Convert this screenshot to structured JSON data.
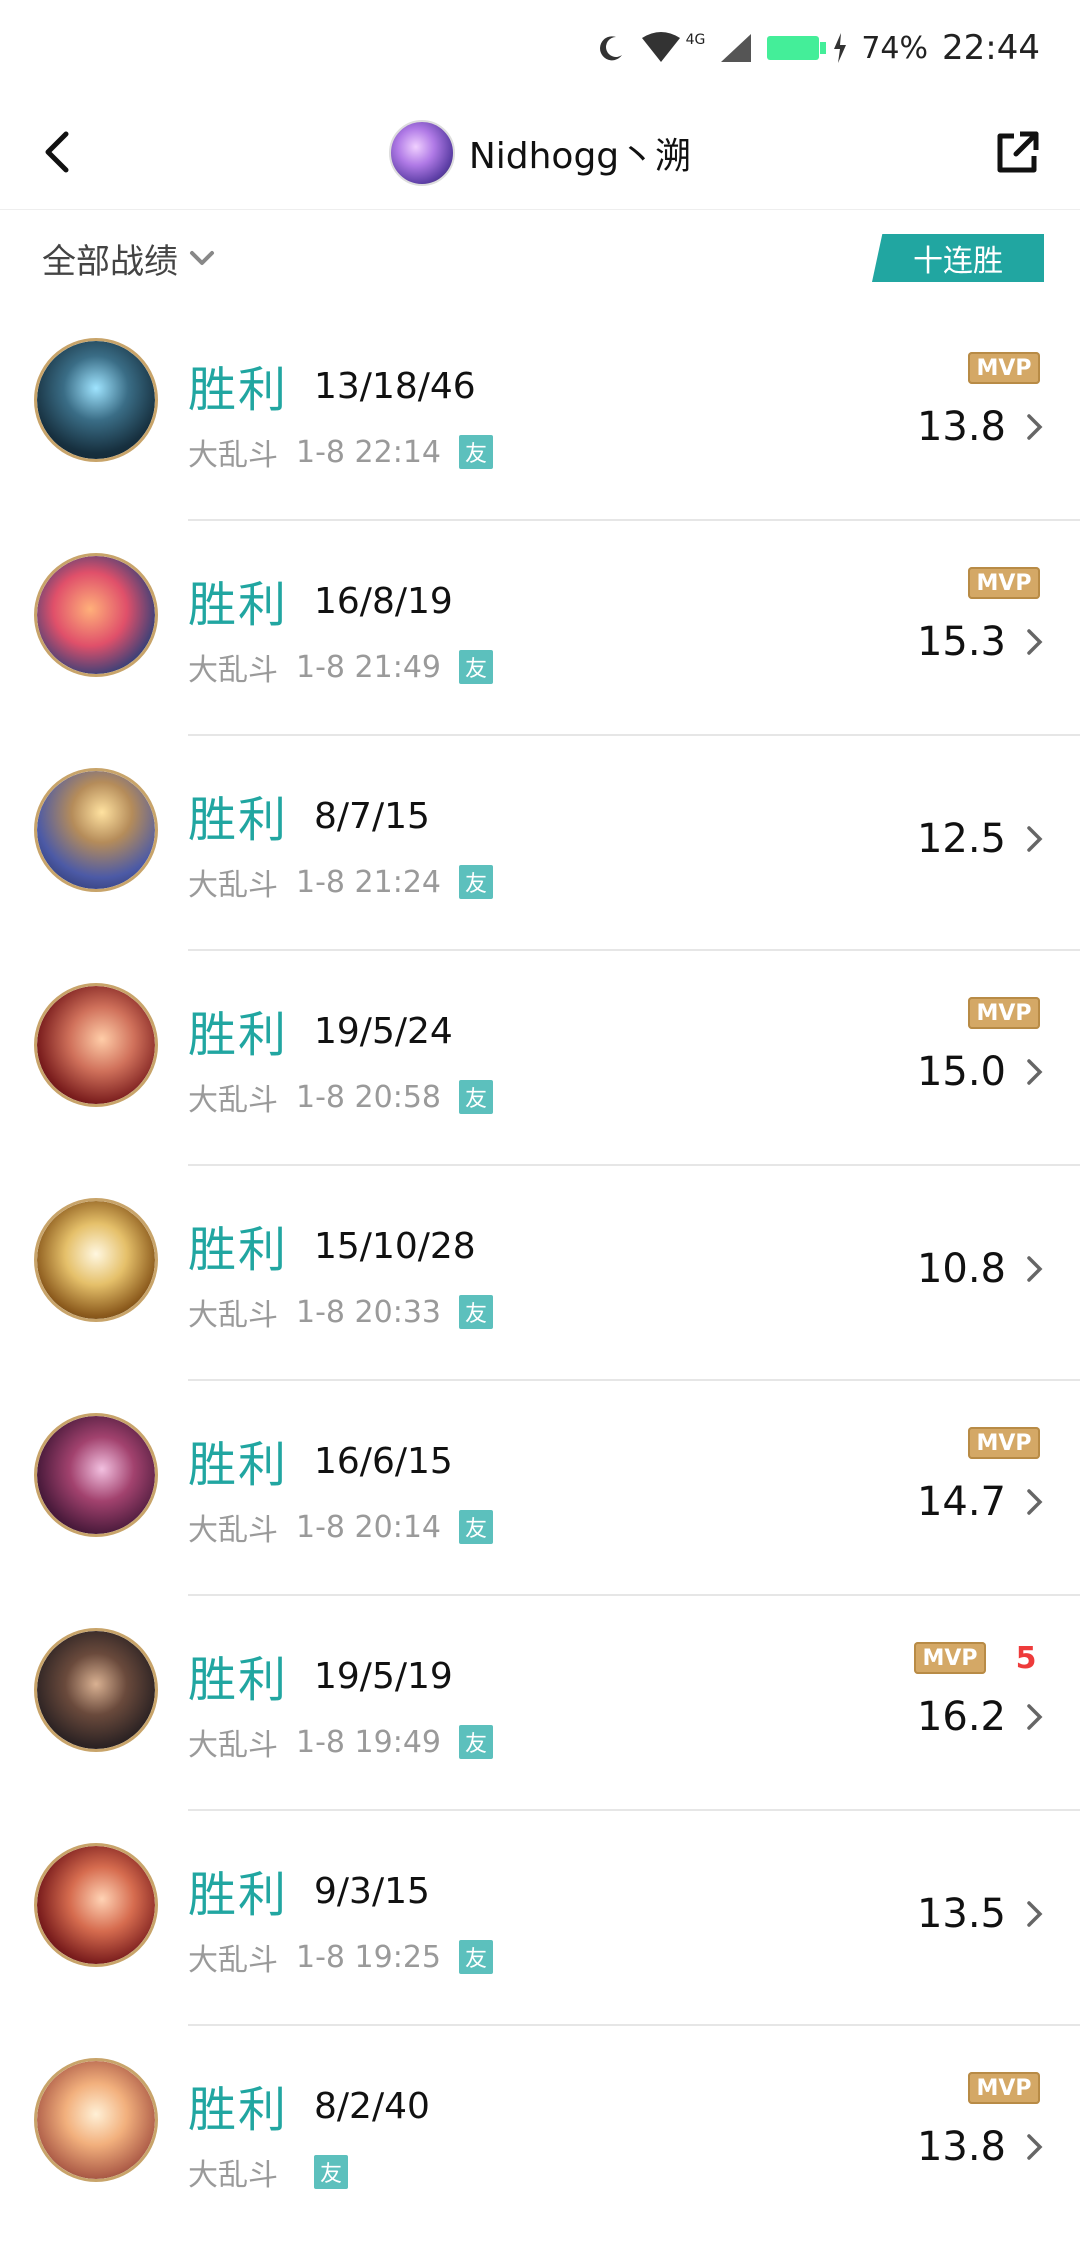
{
  "status_bar": {
    "time": "22:44",
    "battery_percent": "74%",
    "network": "4G"
  },
  "header": {
    "title": "Nidhogg丶溯"
  },
  "filter": {
    "label": "全部战绩",
    "streak_badge": "十连胜"
  },
  "matches": [
    {
      "result": "胜利",
      "kda": "13/18/46",
      "mode": "大乱斗",
      "time": "1-8 22:14",
      "friend": "友",
      "mvp": "MVP",
      "score": "13.8",
      "avatar_icon": "hero-ice-icon"
    },
    {
      "result": "胜利",
      "kda": "16/8/19",
      "mode": "大乱斗",
      "time": "1-8 21:49",
      "friend": "友",
      "mvp": "MVP",
      "score": "15.3",
      "avatar_icon": "hero-red-hair-icon"
    },
    {
      "result": "胜利",
      "kda": "8/7/15",
      "mode": "大乱斗",
      "time": "1-8 21:24",
      "friend": "友",
      "mvp": "",
      "score": "12.5",
      "avatar_icon": "hero-blonde-icon"
    },
    {
      "result": "胜利",
      "kda": "19/5/24",
      "mode": "大乱斗",
      "time": "1-8 20:58",
      "friend": "友",
      "mvp": "MVP",
      "score": "15.0",
      "avatar_icon": "hero-red-woman-icon"
    },
    {
      "result": "胜利",
      "kda": "15/10/28",
      "mode": "大乱斗",
      "time": "1-8 20:33",
      "friend": "友",
      "mvp": "",
      "score": "10.8",
      "avatar_icon": "hero-helmet-icon"
    },
    {
      "result": "胜利",
      "kda": "16/6/15",
      "mode": "大乱斗",
      "time": "1-8 20:14",
      "friend": "友",
      "mvp": "MVP",
      "score": "14.7",
      "avatar_icon": "hero-hooded-icon"
    },
    {
      "result": "胜利",
      "kda": "19/5/19",
      "mode": "大乱斗",
      "time": "1-8 19:49",
      "friend": "友",
      "mvp": "MVP",
      "penta": "5",
      "score": "16.2",
      "avatar_icon": "hero-bearded-icon"
    },
    {
      "result": "胜利",
      "kda": "9/3/15",
      "mode": "大乱斗",
      "time": "1-8 19:25",
      "friend": "友",
      "mvp": "",
      "score": "13.5",
      "avatar_icon": "hero-red-woman-icon"
    },
    {
      "result": "胜利",
      "kda": "8/2/40",
      "mode": "大乱斗",
      "time": "",
      "friend": "友",
      "mvp": "MVP",
      "score": "13.8",
      "avatar_icon": "hero-fair-woman-icon"
    }
  ],
  "colors": {
    "accent": "#21a6a1",
    "mvp_gold": "#d4a866",
    "penta_red": "#ee3b3b"
  }
}
